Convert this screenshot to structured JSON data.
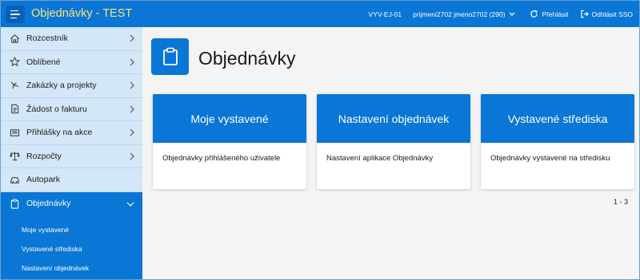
{
  "topbar": {
    "title": "Objednávky - TEST",
    "environment": "VYV-EJ-01",
    "user": "prijmeni2702 jmeno2702 (290)",
    "overview_label": "Přehlásit",
    "logout_label": "Odhlásit SSO"
  },
  "sidebar": {
    "items": [
      {
        "label": "Rozcestník",
        "icon": "home-icon"
      },
      {
        "label": "Oblíbené",
        "icon": "star-icon"
      },
      {
        "label": "Zakázky a projekty",
        "icon": "project-icon"
      },
      {
        "label": "Žádost o fakturu",
        "icon": "invoice-icon"
      },
      {
        "label": "Přihlášky na akce",
        "icon": "registration-icon"
      },
      {
        "label": "Rozpočty",
        "icon": "scales-icon"
      },
      {
        "label": "Autopark",
        "icon": "car-icon"
      },
      {
        "label": "Objednávky",
        "icon": "clipboard-icon"
      }
    ],
    "submenu": [
      "Moje vystavené",
      "Vystavené střediska",
      "Nastavení objednávek"
    ]
  },
  "main": {
    "title": "Objednávky",
    "cards": [
      {
        "title": "Moje vystavené",
        "description": "Objednávky přihlášeného uživatele"
      },
      {
        "title": "Nastavení objednávek",
        "description": "Nastavení aplikace Objednávky"
      },
      {
        "title": "Vystavené střediska",
        "description": "Objednávky vystavené na středisku"
      }
    ],
    "pager": "1 - 3"
  },
  "colors": {
    "accent": "#0a76d5",
    "sidebar_bg": "#d3e7f8",
    "title_yellow": "#ffe37a"
  }
}
